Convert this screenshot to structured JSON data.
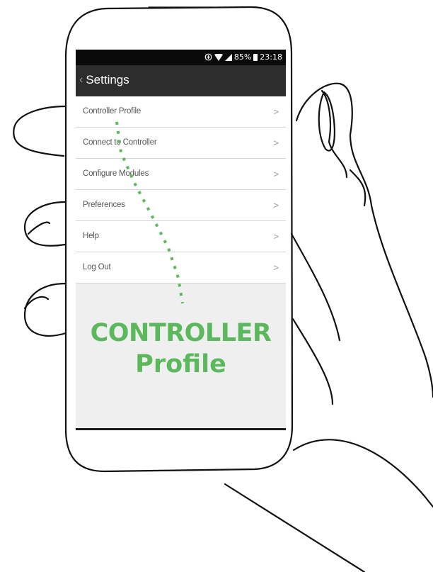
{
  "status_bar": {
    "battery": "85%",
    "time": "23:18"
  },
  "header": {
    "title": "Settings"
  },
  "menu": {
    "items": [
      {
        "label": "Controller Profile",
        "chevron": ">"
      },
      {
        "label": "Connect to Controller",
        "chevron": ">"
      },
      {
        "label": "Configure Modules",
        "chevron": ">"
      },
      {
        "label": "Preferences",
        "chevron": ">"
      },
      {
        "label": "Help",
        "chevron": ">"
      },
      {
        "label": "Log Out",
        "chevron": ">"
      }
    ]
  },
  "annotation": {
    "line1": "CONTROLLER",
    "line2": "Profile",
    "color": "#5cb85c"
  },
  "colors": {
    "status_bar": "#0a0a0a",
    "title_bar": "#2d2d2d",
    "screen_background": "#efefef",
    "menu_item_background": "#ffffff"
  }
}
